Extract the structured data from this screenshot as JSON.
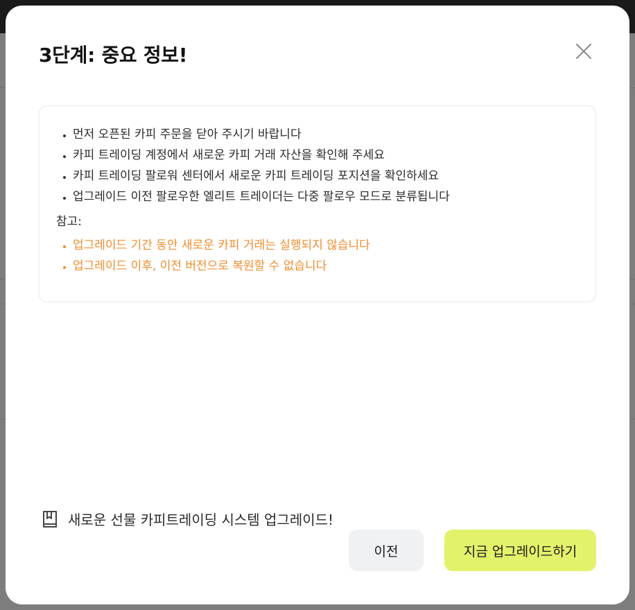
{
  "modal": {
    "title": "3단계: 중요 정보!",
    "close_icon": "close-icon",
    "info_items": [
      "먼저 오픈된 카피 주문을 닫아 주시기 바랍니다",
      "카피 트레이딩 계정에서 새로운 카피 거래 자산을 확인해 주세요",
      "카피 트레이딩 팔로워 센터에서 새로운 카피 트레이딩 포지션을 확인하세요",
      "업그레이드 이전 팔로우한 엘리트 트레이더는 다중 팔로우 모드로 분류됩니다"
    ],
    "note_label": "참고:",
    "warning_items": [
      "업그레이드 기간 동안 새로운 카피 거래는 실행되지 않습니다",
      "업그레이드 이후, 이전 버전으로 복원할 수 없습니다"
    ],
    "footer_link": {
      "icon": "book-icon",
      "label": "새로운 선물 카피트레이딩 시스템 업그레이드!"
    },
    "buttons": {
      "prev": "이전",
      "upgrade": "지금 업그레이드하기"
    }
  },
  "colors": {
    "warning": "#f08c2e",
    "primary_button": "#e2f26b",
    "secondary_button": "#f0f1f3"
  }
}
